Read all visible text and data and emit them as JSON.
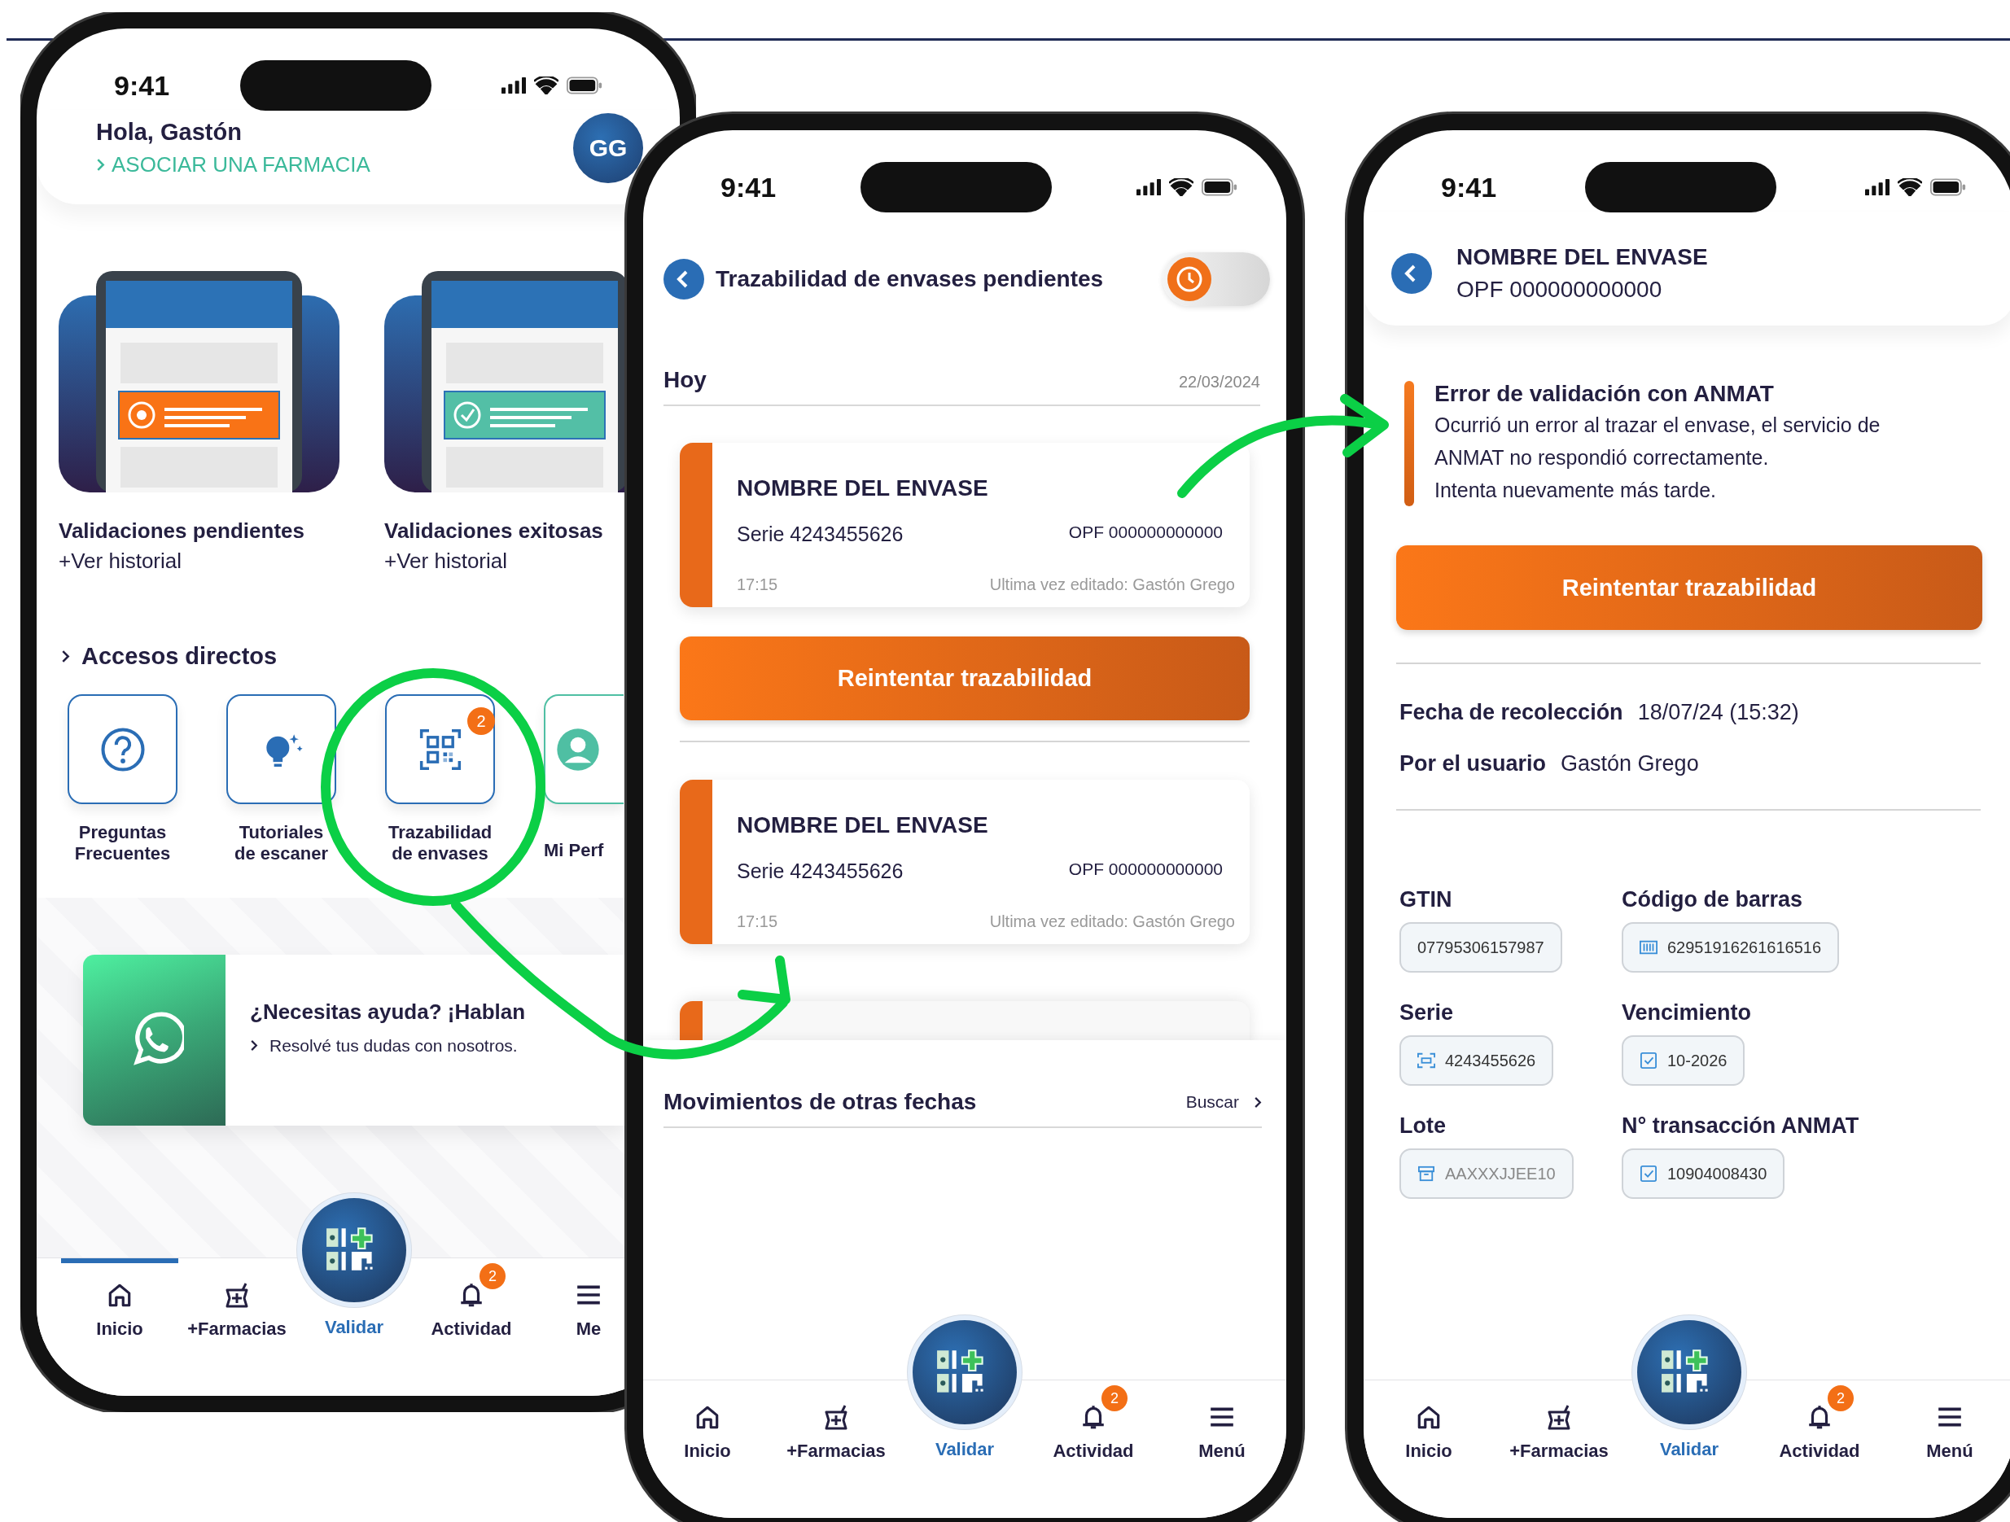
{
  "home_screen": {
    "status_bar": {
      "time": "9:41"
    },
    "greeting": "Hola, Gastón",
    "link": "ASOCIAR UNA FARMACIA",
    "avatar": "GG",
    "summary_cards": [
      {
        "kind": "pending",
        "title": "Validaciones pendientes",
        "link": "+Ver historial"
      },
      {
        "kind": "success",
        "title": "Validaciones exitosas",
        "link": "+Ver historial"
      }
    ],
    "section_title": "Accesos directos",
    "shortcuts": [
      {
        "kind": "question",
        "label": "Preguntas Frecuentes"
      },
      {
        "kind": "bulb",
        "label": "Tutoriales de escaner"
      },
      {
        "kind": "qr",
        "label": "Trazabilidad de envases",
        "badge": "2"
      },
      {
        "kind": "profile",
        "label": "Mi Perf"
      }
    ],
    "help_banner": {
      "title": "¿Necesitas ayuda? ¡Hablan",
      "subtitle": "Resolvé tus dudas con nosotros."
    },
    "nav_bar": [
      {
        "kind": "home",
        "label": "Inicio",
        "selected": true
      },
      {
        "kind": "pharmacy",
        "label": "+Farmacias",
        "selected": false
      },
      {
        "kind": "validate",
        "label": "Validar",
        "selected": false
      },
      {
        "kind": "bell",
        "label": "Actividad",
        "badge": "2",
        "selected": false
      },
      {
        "kind": "menu",
        "label": "Me",
        "selected": false
      }
    ]
  },
  "pending_screen": {
    "status_bar": {
      "time": "9:41"
    },
    "title": "Trazabilidad de envases pendientes",
    "history_toggle": {
      "on": false
    },
    "day": {
      "label": "Hoy",
      "date": "22/03/2024"
    },
    "entries": [
      {
        "kind": "envase",
        "name": "NOMBRE DEL ENVASE",
        "serie": "Serie 4243455626",
        "opf": "OPF 000000000000",
        "time": "17:15",
        "edited": "Ultima vez editado: Gastón Grego"
      },
      {
        "kind": "action",
        "label": "Reintentar trazabilidad"
      },
      {
        "kind": "envase",
        "name": "NOMBRE DEL ENVASE",
        "serie": "Serie 4243455626",
        "opf": "OPF 000000000000",
        "time": "17:15",
        "edited": "Ultima vez editado: Gastón Grego"
      }
    ],
    "other_dates": {
      "title": "Movimientos de otras fechas",
      "action": "Buscar"
    },
    "nav_bar": [
      {
        "kind": "home",
        "label": "Inicio",
        "selected": false
      },
      {
        "kind": "pharmacy",
        "label": "+Farmacias",
        "selected": false
      },
      {
        "kind": "validate",
        "label": "Validar",
        "selected": false
      },
      {
        "kind": "bell",
        "label": "Actividad",
        "badge": "2",
        "selected": false
      },
      {
        "kind": "menu",
        "label": "Menú",
        "selected": false
      }
    ]
  },
  "detail_screen": {
    "status_bar": {
      "time": "9:41"
    },
    "name": "NOMBRE DEL ENVASE",
    "opf": "OPF 000000000000",
    "error": {
      "title": "Error de validación con ANMAT",
      "message": "Ocurrió un error al trazar el envase, el servicio de ANMAT no respondió correctamente.",
      "hint": "Intenta nuevamente más tarde."
    },
    "retry_button": "Reintentar trazabilidad",
    "info": [
      {
        "label": "Fecha de recolección",
        "value": "18/07/24 (15:32)"
      },
      {
        "label": "Por el usuario",
        "value": "Gastón Grego"
      }
    ],
    "fields": [
      {
        "kind": "plain",
        "label": "GTIN",
        "value": "07795306157987"
      },
      {
        "kind": "barcode",
        "label": "Código de barras",
        "value": "62951916261616516"
      },
      {
        "kind": "scan",
        "label": "Serie",
        "value": "4243455626"
      },
      {
        "kind": "check",
        "label": "Vencimiento",
        "value": "10-2026"
      },
      {
        "kind": "box",
        "label": "Lote",
        "value": "AAXXXJJEE10"
      },
      {
        "kind": "check",
        "label": "N° transacción ANMAT",
        "value": "10904008430"
      }
    ],
    "nav_bar": [
      {
        "kind": "home",
        "label": "Inicio",
        "selected": false
      },
      {
        "kind": "pharmacy",
        "label": "+Farmacias",
        "selected": false
      },
      {
        "kind": "validate",
        "label": "Validar",
        "selected": false
      },
      {
        "kind": "bell",
        "label": "Actividad",
        "badge": "2",
        "selected": false
      },
      {
        "kind": "menu",
        "label": "Menú",
        "selected": false
      }
    ]
  }
}
